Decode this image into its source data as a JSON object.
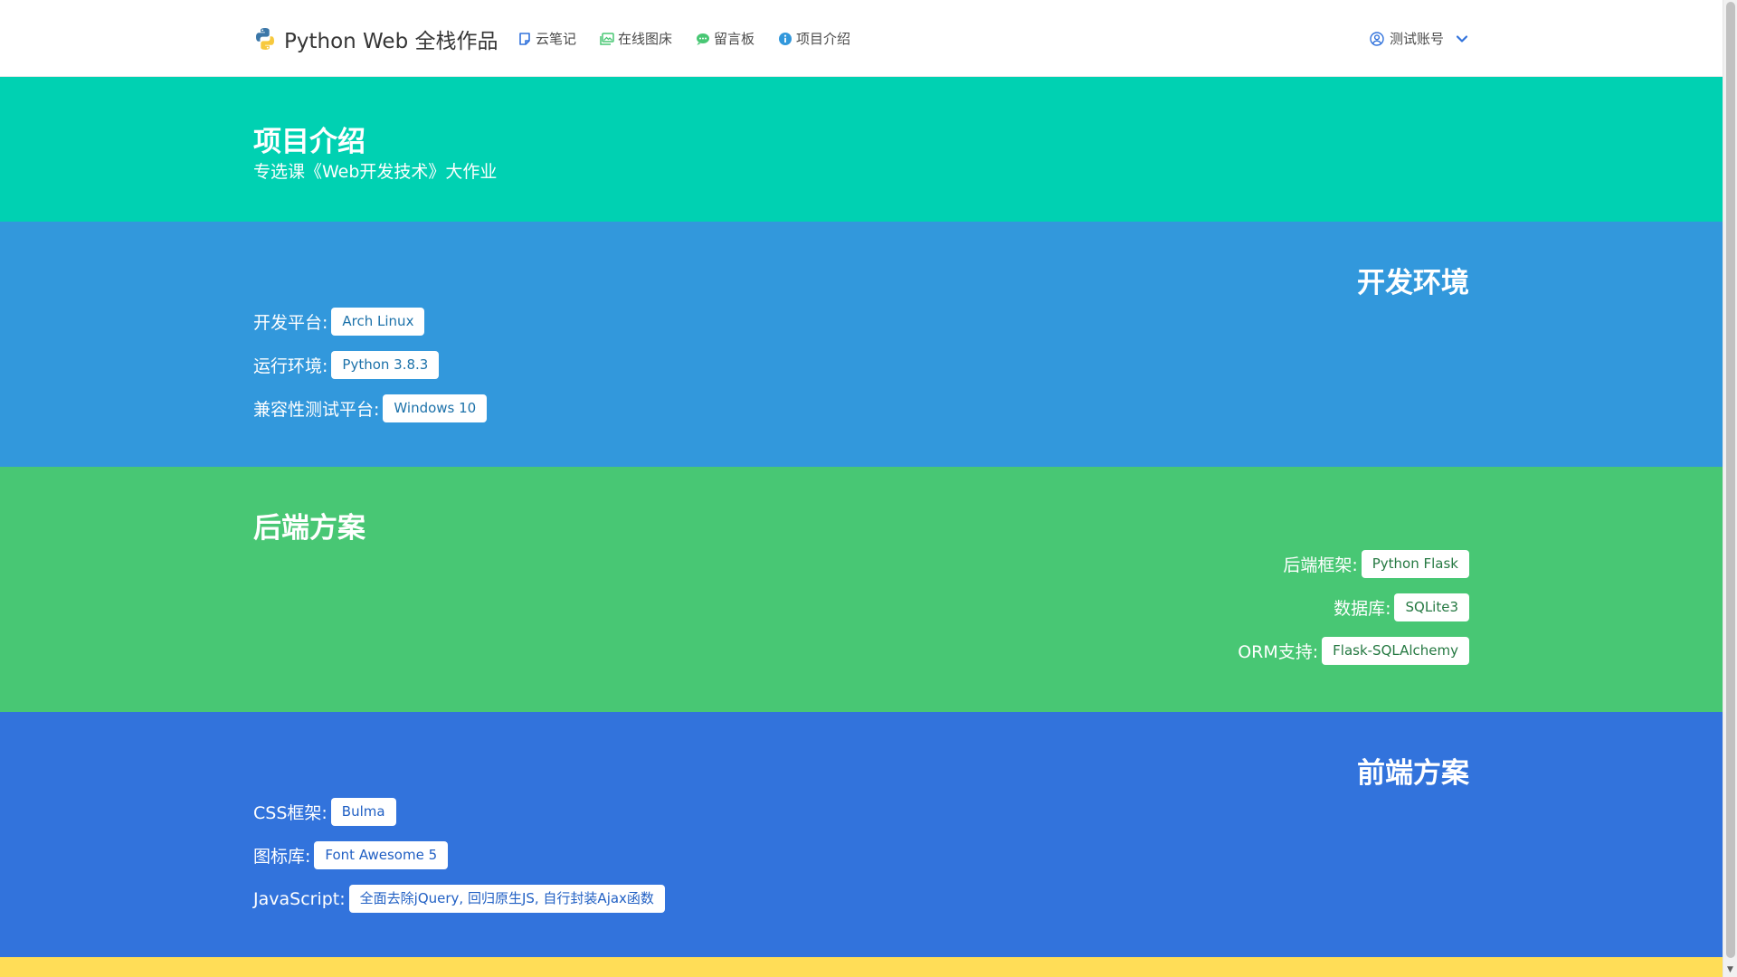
{
  "navbar": {
    "brand": "Python Web 全栈作品",
    "items": [
      {
        "label": "云笔记",
        "icon": "note-icon"
      },
      {
        "label": "在线图床",
        "icon": "images-icon"
      },
      {
        "label": "留言板",
        "icon": "comments-icon"
      },
      {
        "label": "项目介绍",
        "icon": "info-circle-icon"
      }
    ],
    "account": "测试账号"
  },
  "hero": {
    "title": "项目介绍",
    "subtitle": "专选课《Web开发技术》大作业"
  },
  "env": {
    "title": "开发环境",
    "rows": [
      {
        "label": "开发平台:",
        "value": "Arch Linux"
      },
      {
        "label": "运行环境:",
        "value": "Python 3.8.3"
      },
      {
        "label": "兼容性测试平台:",
        "value": "Windows 10"
      }
    ]
  },
  "backend": {
    "title": "后端方案",
    "rows": [
      {
        "label": "后端框架:",
        "value": "Python Flask"
      },
      {
        "label": "数据库:",
        "value": "SQLite3"
      },
      {
        "label": "ORM支持:",
        "value": "Flask-SQLAlchemy"
      }
    ]
  },
  "frontend": {
    "title": "前端方案",
    "rows": [
      {
        "label": "CSS框架:",
        "value": "Bulma"
      },
      {
        "label": "图标库:",
        "value": "Font Awesome 5"
      },
      {
        "label": "JavaScript:",
        "value": "全面去除jQuery, 回归原生JS, 自行封装Ajax函数"
      }
    ]
  },
  "colors": {
    "primary": "#00d1b2",
    "info": "#3298dc",
    "success": "#48c774",
    "link": "#3273dc",
    "warning": "#ffdd57"
  }
}
